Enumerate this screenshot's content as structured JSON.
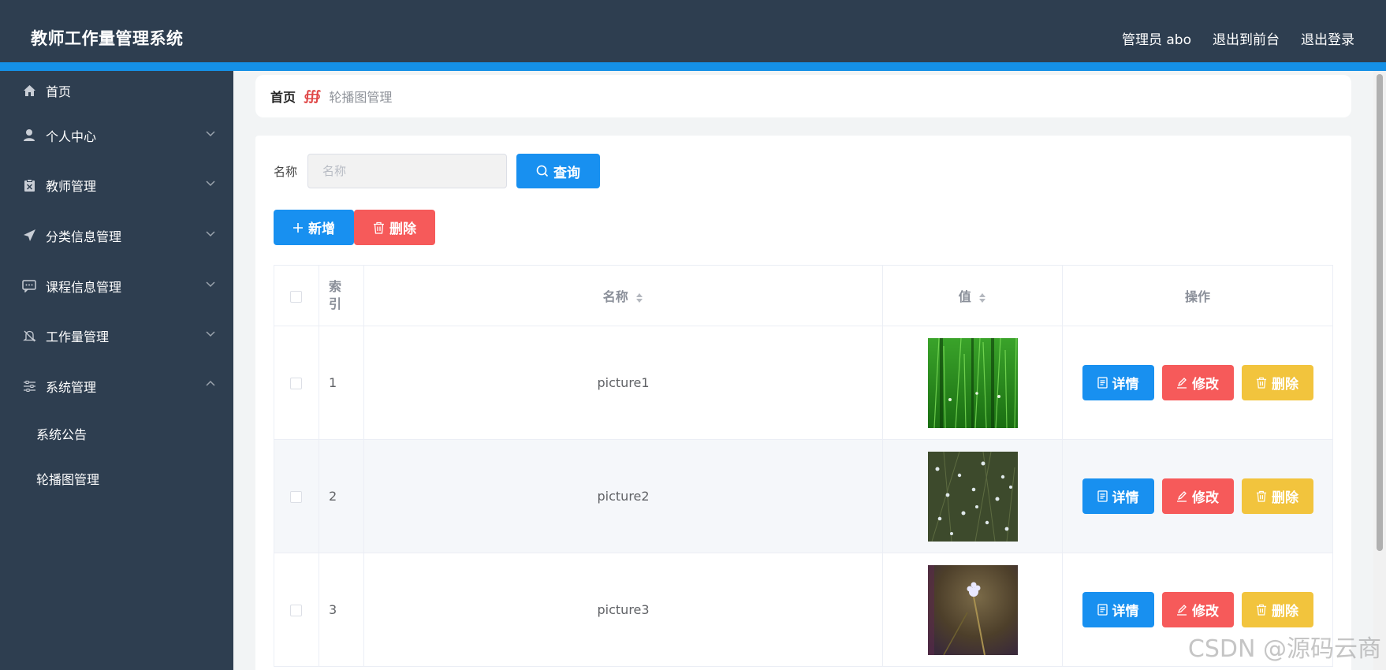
{
  "header": {
    "title": "教师工作量管理系统",
    "user_label": "管理员 abo",
    "front_link": "退出到前台",
    "logout_link": "退出登录"
  },
  "sidebar": {
    "items": [
      {
        "label": "首页",
        "icon": "home-icon"
      },
      {
        "label": "个人中心",
        "icon": "user-icon"
      },
      {
        "label": "教师管理",
        "icon": "clipboard-icon"
      },
      {
        "label": "分类信息管理",
        "icon": "paper-plane-icon"
      },
      {
        "label": "课程信息管理",
        "icon": "message-icon"
      },
      {
        "label": "工作量管理",
        "icon": "bell-off-icon"
      },
      {
        "label": "系统管理",
        "icon": "sliders-icon"
      }
    ],
    "sub_items": [
      {
        "label": "系统公告"
      },
      {
        "label": "轮播图管理"
      }
    ]
  },
  "breadcrumb": {
    "home": "首页",
    "separator": "∰",
    "current": "轮播图管理"
  },
  "search": {
    "label": "名称",
    "placeholder": "名称",
    "value": "",
    "button_label": "查询"
  },
  "actions": {
    "add_label": "新增",
    "delete_label": "删除"
  },
  "table": {
    "headers": {
      "index": "索引",
      "name": "名称",
      "value": "值",
      "ops": "操作"
    },
    "rows": [
      {
        "index": "1",
        "name": "picture1",
        "image": "green-grass"
      },
      {
        "index": "2",
        "name": "picture2",
        "image": "dark-grass-white-flowers"
      },
      {
        "index": "3",
        "name": "picture3",
        "image": "white-flower-brown"
      }
    ],
    "op_labels": {
      "detail": "详情",
      "edit": "修改",
      "delete": "删除"
    }
  },
  "watermark": "CSDN @源码云商",
  "colors": {
    "header_bg": "#2e3e50",
    "accent": "#1590e6",
    "primary": "#1890f0",
    "danger": "#f65a5a",
    "warning": "#f2c43d"
  }
}
